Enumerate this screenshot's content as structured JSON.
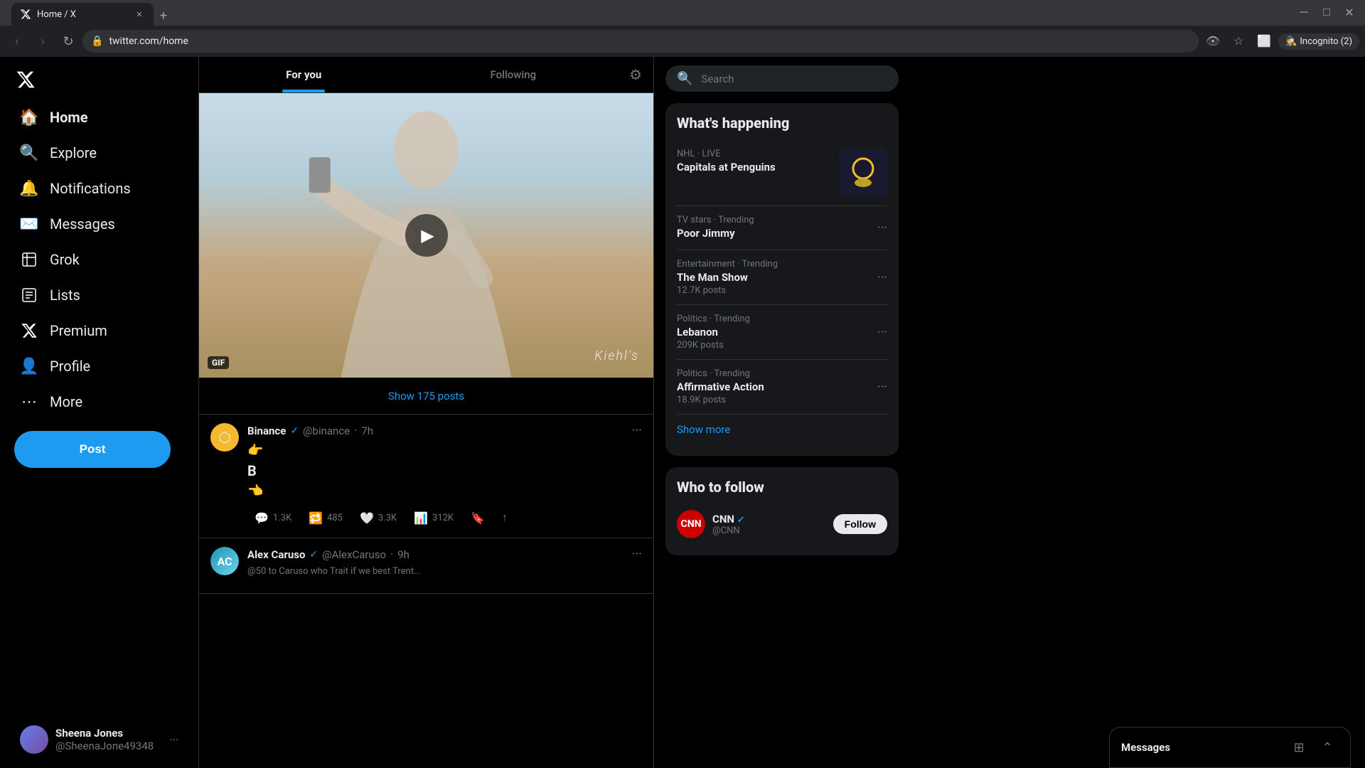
{
  "browser": {
    "tab_title": "Home / X",
    "url": "twitter.com/home",
    "incognito_label": "Incognito (2)"
  },
  "sidebar": {
    "items": [
      {
        "id": "home",
        "label": "Home",
        "icon": "🏠",
        "active": true
      },
      {
        "id": "explore",
        "label": "Explore",
        "icon": "🔍"
      },
      {
        "id": "notifications",
        "label": "Notifications",
        "icon": "🔔"
      },
      {
        "id": "messages",
        "label": "Messages",
        "icon": "✉️"
      },
      {
        "id": "grok",
        "label": "Grok",
        "icon": "✏️"
      },
      {
        "id": "lists",
        "label": "Lists",
        "icon": "📋"
      },
      {
        "id": "premium",
        "label": "Premium",
        "icon": "✖"
      },
      {
        "id": "profile",
        "label": "Profile",
        "icon": "👤"
      },
      {
        "id": "more",
        "label": "More",
        "icon": "⋯"
      }
    ],
    "post_button": "Post",
    "user": {
      "name": "Sheena Jones",
      "handle": "@SheenaJone49348"
    }
  },
  "main": {
    "tabs": [
      {
        "id": "for-you",
        "label": "For you",
        "active": true
      },
      {
        "id": "following",
        "label": "Following"
      }
    ],
    "show_posts": "Show 175 posts",
    "gif_label": "GIF",
    "watermark": "Kiehl's",
    "tweets": [
      {
        "id": "binance",
        "name": "Binance",
        "handle": "@binance",
        "time": "7h",
        "verified": true,
        "text_emoji1": "👉",
        "text_letter": "B",
        "text_emoji2": "👈",
        "replies": "1.3K",
        "retweets": "485",
        "likes": "3.3K",
        "views": "312K"
      },
      {
        "id": "alex",
        "name": "Alex Caruso",
        "handle": "@AlexCaruso",
        "time": "9h",
        "verified": true
      }
    ]
  },
  "right_sidebar": {
    "search_placeholder": "Search",
    "whats_happening_title": "What's happening",
    "trending_items": [
      {
        "id": "nhl",
        "meta": "NHL · LIVE",
        "label": "Capitals at Penguins",
        "has_image": true
      },
      {
        "id": "tv_stars",
        "meta": "TV stars · Trending",
        "label": "Poor Jimmy"
      },
      {
        "id": "entertainment",
        "meta": "Entertainment · Trending",
        "label": "The Man Show",
        "count": "12.7K posts"
      },
      {
        "id": "politics_lebanon",
        "meta": "Politics · Trending",
        "label": "Lebanon",
        "count": "209K posts"
      },
      {
        "id": "politics_affirmative",
        "meta": "Politics · Trending",
        "label": "Affirmative Action",
        "count": "18.9K posts"
      }
    ],
    "show_more": "Show more",
    "who_to_follow_title": "Who to follow",
    "follow_items": [
      {
        "id": "cnn",
        "name": "CNN",
        "verified": true,
        "color": "#cc0000"
      }
    ]
  },
  "messages_panel": {
    "title": "Messages"
  }
}
